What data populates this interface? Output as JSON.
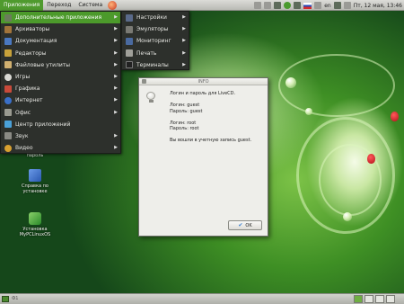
{
  "top_panel": {
    "menus": [
      "Приложения",
      "Переход",
      "Система"
    ],
    "active_menu": 0,
    "tray": {
      "language": "en",
      "clock": "Пт, 12 мая, 13:46"
    }
  },
  "main_menu": {
    "items": [
      {
        "label": "Дополнительные приложения",
        "icon": "folder-icon",
        "color": "#6b7c5c",
        "selected": true
      },
      {
        "label": "Архиваторы",
        "icon": "archive-icon",
        "color": "#a2743a"
      },
      {
        "label": "Документация",
        "icon": "help-icon",
        "color": "#4a78c0"
      },
      {
        "label": "Редакторы",
        "icon": "text-editor-icon",
        "color": "#c8a23a"
      },
      {
        "label": "Файловые утилиты",
        "icon": "file-manager-icon",
        "color": "#d0b070"
      },
      {
        "label": "Игры",
        "icon": "games-icon",
        "color": "#d9d9d4"
      },
      {
        "label": "Графика",
        "icon": "graphics-icon",
        "color": "#c84a3a"
      },
      {
        "label": "Интернет",
        "icon": "internet-icon",
        "color": "#3a6fc8"
      },
      {
        "label": "Офис",
        "icon": "office-icon",
        "color": "#9a9a90"
      },
      {
        "label": "Центр приложений",
        "icon": "app-center-icon",
        "color": "#4aa0d8"
      },
      {
        "label": "Звук",
        "icon": "sound-icon",
        "color": "#8a8a84"
      },
      {
        "label": "Видео",
        "icon": "video-icon",
        "color": "#d8a030"
      }
    ]
  },
  "submenu": {
    "items": [
      {
        "label": "Настройки",
        "icon": "settings-icon",
        "color": "#5a6a8a"
      },
      {
        "label": "Эмуляторы",
        "icon": "emulator-icon",
        "color": "#7a7a74"
      },
      {
        "label": "Мониторинг",
        "icon": "monitor-icon",
        "color": "#4a6aa0"
      },
      {
        "label": "Печать",
        "icon": "printer-icon",
        "color": "#a0a09a"
      },
      {
        "label": "Терминалы",
        "icon": "terminal-icon",
        "color": "#222222"
      }
    ]
  },
  "dialog": {
    "title": "INFO",
    "lines": [
      "Логин и пароль для LiveCD.",
      "",
      "Логин: guest",
      "Пароль: guest",
      "",
      "Логин: root",
      "Пароль: root",
      "",
      "Вы вошли в учетную запись guest."
    ],
    "ok_label": "OK"
  },
  "desktop_icons": [
    {
      "label": "пароль",
      "label2": "",
      "icon": "document-icon",
      "color": "#dcdcd6"
    },
    {
      "label": "Справка по",
      "label2": "установке",
      "icon": "help-book-icon",
      "color": "#3a70c8"
    },
    {
      "label": "Установка",
      "label2": "MyPCLinuxOS",
      "icon": "install-icon",
      "color": "#3a9a3a"
    }
  ],
  "bottom_panel": {
    "label": "Ф1"
  }
}
